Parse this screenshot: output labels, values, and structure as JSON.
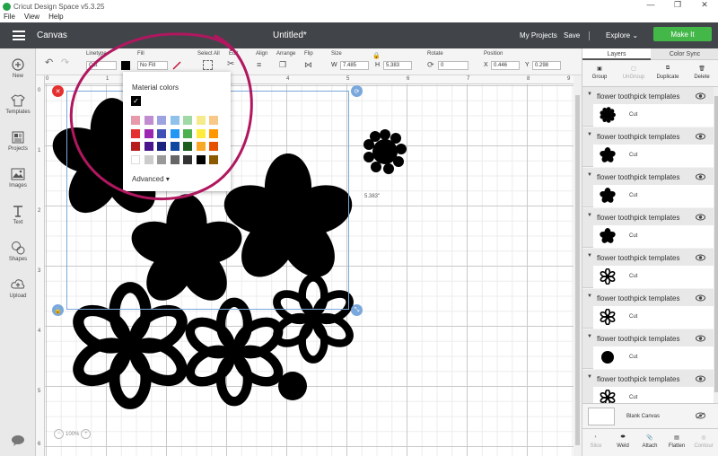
{
  "titlebar": {
    "title": "Cricut Design Space  v5.3.25",
    "min": "—",
    "max": "❐",
    "close": "✕"
  },
  "menu": [
    "File",
    "View",
    "Help"
  ],
  "header": {
    "canvas_label": "Canvas",
    "document_title": "Untitled*",
    "my_projects": "My Projects",
    "save": "Save",
    "divider": "|",
    "explore": "Explore",
    "make_it": "Make It"
  },
  "sidebar": [
    {
      "label": "New",
      "icon": "plus-circle-icon"
    },
    {
      "label": "Templates",
      "icon": "tshirt-icon"
    },
    {
      "label": "Projects",
      "icon": "projects-icon"
    },
    {
      "label": "Images",
      "icon": "image-icon"
    },
    {
      "label": "Text",
      "icon": "text-icon"
    },
    {
      "label": "Shapes",
      "icon": "shapes-icon"
    },
    {
      "label": "Upload",
      "icon": "upload-icon"
    }
  ],
  "toolbar": {
    "linetype_label": "Linetype",
    "linetype_value": "Cut",
    "fill_label": "Fill",
    "fill_value": "No Fill",
    "select_all": "Select All",
    "edit": "Edit",
    "align": "Align",
    "arrange": "Arrange",
    "flip": "Flip",
    "size": "Size",
    "w_label": "W",
    "w_value": "7.485",
    "h_label": "H",
    "h_value": "5.383",
    "rotate": "Rotate",
    "rotate_value": "0",
    "position": "Position",
    "x_label": "X",
    "x_value": "0.446",
    "y_label": "Y",
    "y_value": "0.298",
    "colors": {
      "linetype_swatch": "#000000",
      "fill_slash": "#c0143c"
    }
  },
  "rulers": {
    "top": [
      "0",
      "1",
      "2",
      "3",
      "4",
      "5",
      "6",
      "7",
      "8",
      "9"
    ],
    "left": [
      "0",
      "1",
      "2",
      "3",
      "4",
      "5",
      "6"
    ]
  },
  "popover": {
    "title": "Material colors",
    "check": "✓",
    "advanced": "Advanced",
    "swatches": [
      [
        "#e69aaa",
        "#c08ed0",
        "#9da3e0",
        "#8ec2ea",
        "#9fd9a6",
        "#f5ea8c",
        "#f7c887"
      ],
      [
        "#e53030",
        "#9c27b0",
        "#3f51b5",
        "#2196f3",
        "#4caf50",
        "#ffeb3b",
        "#ff9800"
      ],
      [
        "#b71c1c",
        "#4a148c",
        "#1a237e",
        "#0d47a1",
        "#1b5e20",
        "#f9a825",
        "#e65100"
      ],
      [
        "#ffffff",
        "#cccccc",
        "#999999",
        "#666666",
        "#333333",
        "#000000",
        "#8b5a00"
      ]
    ]
  },
  "canvas": {
    "dimension_label": "5.383\"",
    "zoom_value": "100%",
    "zoom_minus": "−",
    "zoom_plus": "+"
  },
  "right_panel": {
    "tabs": [
      "Layers",
      "Color Sync"
    ],
    "actions": [
      {
        "label": "Group",
        "disabled": false
      },
      {
        "label": "UnGroup",
        "disabled": true
      },
      {
        "label": "Duplicate",
        "disabled": false
      },
      {
        "label": "Delete",
        "disabled": false
      }
    ],
    "layers": [
      {
        "title": "flower toothpick templates",
        "sub": "Cut",
        "thumb": "flower-round-thumb"
      },
      {
        "title": "flower toothpick templates",
        "sub": "Cut",
        "thumb": "flower-solid-thumb"
      },
      {
        "title": "flower toothpick templates",
        "sub": "Cut",
        "thumb": "flower-solid-thumb"
      },
      {
        "title": "flower toothpick templates",
        "sub": "Cut",
        "thumb": "flower-solid-thumb"
      },
      {
        "title": "flower toothpick templates",
        "sub": "Cut",
        "thumb": "flower-outline-thumb"
      },
      {
        "title": "flower toothpick templates",
        "sub": "Cut",
        "thumb": "flower-outline-thumb"
      },
      {
        "title": "flower toothpick templates",
        "sub": "Cut",
        "thumb": "circle-thumb"
      },
      {
        "title": "flower toothpick templates",
        "sub": "Cut",
        "thumb": "flower-outline-thumb"
      }
    ],
    "blank_canvas": "Blank Canvas",
    "bottom_actions": [
      {
        "label": "Slice",
        "disabled": true
      },
      {
        "label": "Weld",
        "disabled": false
      },
      {
        "label": "Attach",
        "disabled": false
      },
      {
        "label": "Flatten",
        "disabled": false
      },
      {
        "label": "Contour",
        "disabled": true
      }
    ]
  }
}
